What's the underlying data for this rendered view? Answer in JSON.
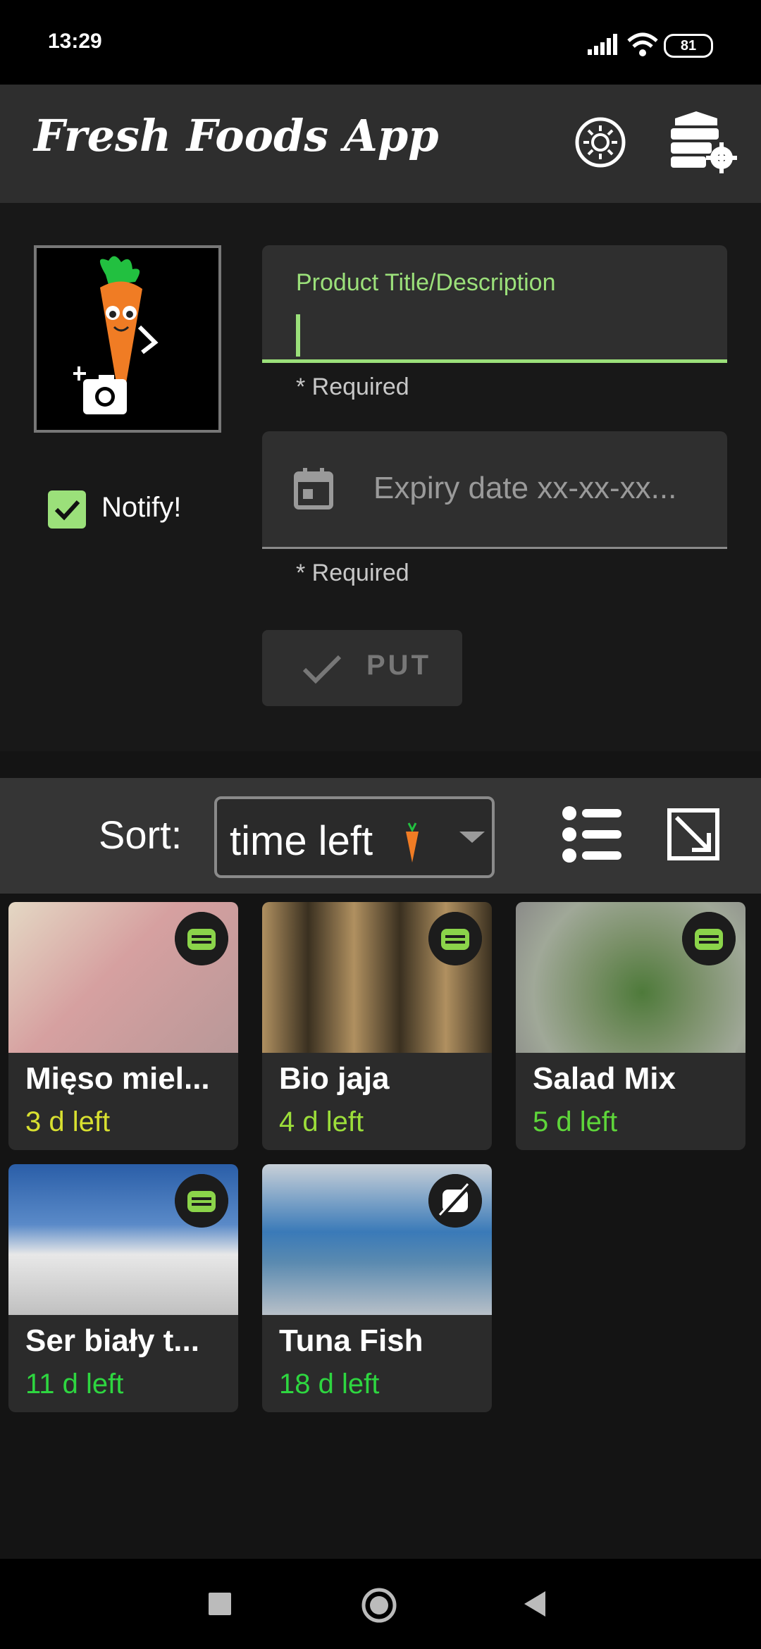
{
  "status_bar": {
    "time": "13:29",
    "battery": "81"
  },
  "app_bar": {
    "title": "Fresh Foods App",
    "theme_icon": "brightness-icon",
    "settings_icon": "database-settings-icon"
  },
  "form": {
    "title_field": {
      "label": "Product Title/Description",
      "helper": "* Required"
    },
    "date_field": {
      "placeholder": "Expiry date xx-xx-xx...",
      "helper": "* Required"
    },
    "notify": {
      "label": "Notify!",
      "checked": true
    },
    "put_button": {
      "label": "PUT"
    }
  },
  "sort_bar": {
    "label": "Sort:",
    "selected": "time left"
  },
  "products": [
    {
      "name": "Mięso miel...",
      "days_left": "3 d left",
      "days_color": "#d8e030",
      "thumb": "#c8b8a8"
    },
    {
      "name": "Bio jaja",
      "days_left": "4 d left",
      "days_color": "#9cde3a",
      "thumb": "#a88a58"
    },
    {
      "name": "Salad Mix",
      "days_left": "5 d left",
      "days_color": "#5ed63a",
      "thumb": "#8a9a78"
    },
    {
      "name": "Ser biały t...",
      "days_left": "11 d left",
      "days_color": "#2ed640",
      "thumb": "#5a86c0"
    },
    {
      "name": "Tuna Fish",
      "days_left": "18 d left",
      "days_color": "#2ed640",
      "thumb": "#a8b8c8"
    }
  ],
  "colors": {
    "accent": "#9be07a",
    "appbar": "#2e2e2e",
    "background": "#141414"
  }
}
